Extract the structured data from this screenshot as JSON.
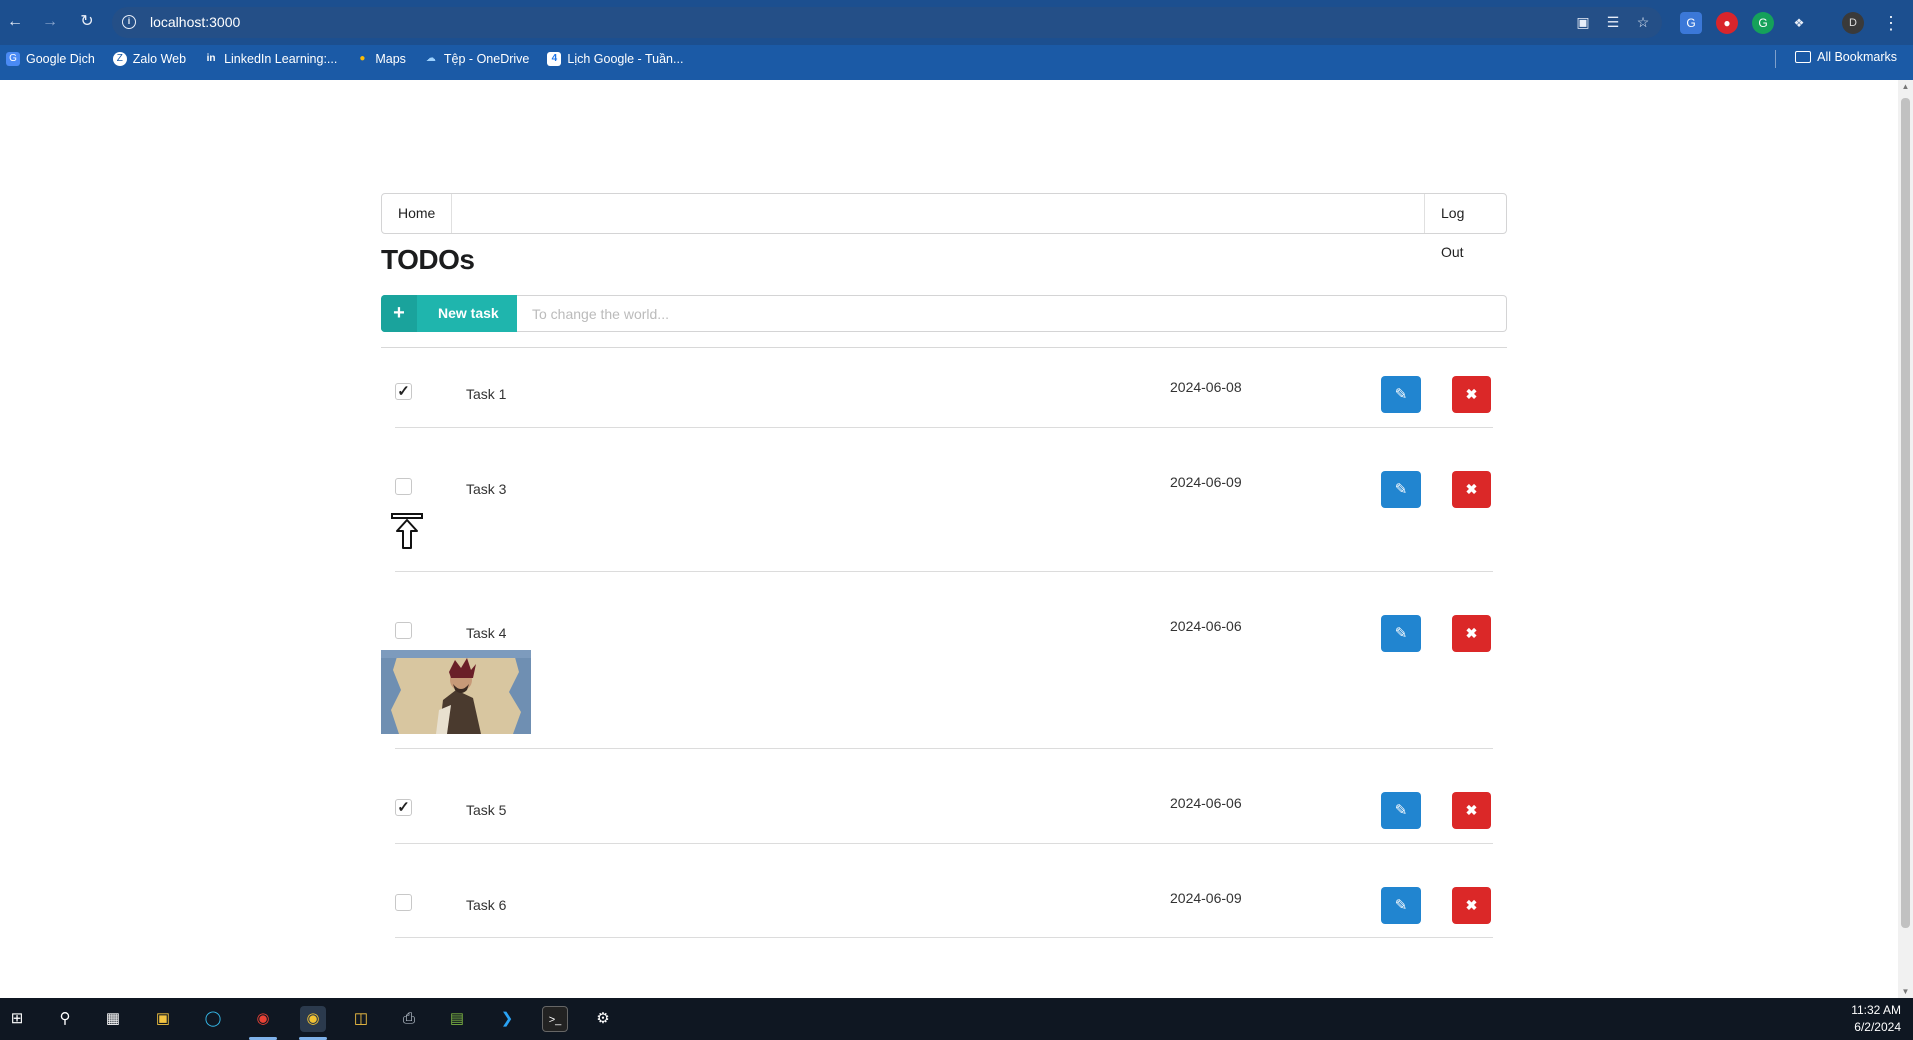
{
  "browser": {
    "url": "localhost:3000",
    "bookmarks": [
      {
        "label": "Google Dịch",
        "icon": "google-translate-icon"
      },
      {
        "label": "Zalo Web",
        "icon": "zalo-icon"
      },
      {
        "label": "LinkedIn Learning:...",
        "icon": "linkedin-icon"
      },
      {
        "label": "Maps",
        "icon": "maps-icon"
      },
      {
        "label": "Tệp - OneDrive",
        "icon": "onedrive-icon"
      },
      {
        "label": "Lịch Google - Tuần...",
        "icon": "google-calendar-icon"
      }
    ],
    "all_bookmarks": "All Bookmarks",
    "profile_initial": "D"
  },
  "nav": {
    "home": "Home",
    "logout": "Log Out"
  },
  "page": {
    "title": "TODOs"
  },
  "new_task": {
    "button_label": "New task",
    "placeholder": "To change the world..."
  },
  "tasks": [
    {
      "name": "Task 1",
      "date": "2024-06-08",
      "done": true
    },
    {
      "name": "Task 3",
      "date": "2024-06-09",
      "done": false
    },
    {
      "name": "Task 4",
      "date": "2024-06-06",
      "done": false
    },
    {
      "name": "Task 5",
      "date": "2024-06-06",
      "done": true
    },
    {
      "name": "Task 6",
      "date": "2024-06-09",
      "done": false
    }
  ],
  "taskbar": {
    "time": "11:32 AM",
    "date": "6/2/2024"
  },
  "colors": {
    "chrome_bar": "#1b5aa6",
    "new_task_teal": "#1fb5ad",
    "edit_blue": "#2185d0",
    "delete_red": "#db2828"
  }
}
